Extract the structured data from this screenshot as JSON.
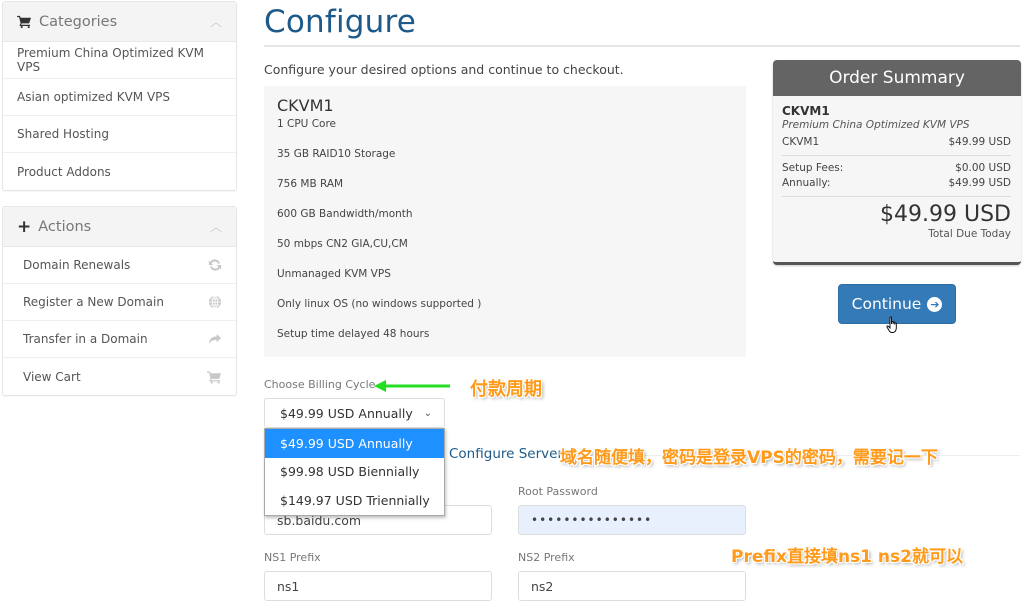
{
  "sidebar": {
    "categories": {
      "title": "Categories",
      "icon": "shopping-cart-icon",
      "items": [
        {
          "label": "Premium China Optimized KVM VPS"
        },
        {
          "label": "Asian optimized KVM VPS"
        },
        {
          "label": "Shared Hosting"
        },
        {
          "label": "Product Addons"
        }
      ]
    },
    "actions": {
      "title": "Actions",
      "icon": "plus-icon",
      "items": [
        {
          "label": "Domain Renewals",
          "icon": "refresh-icon"
        },
        {
          "label": "Register a New Domain",
          "icon": "globe-icon"
        },
        {
          "label": "Transfer in a Domain",
          "icon": "share-arrow-icon"
        },
        {
          "label": "View Cart",
          "icon": "shopping-cart-icon"
        }
      ]
    }
  },
  "main": {
    "title": "Configure",
    "intro": "Configure your desired options and continue to checkout.",
    "product": {
      "name": "CKVM1",
      "features": [
        "1 CPU Core",
        "35 GB RAID10 Storage",
        "756 MB RAM",
        "600 GB Bandwidth/month",
        "50 mbps CN2 GIA,CU,CM",
        "Unmanaged KVM VPS",
        "Only linux OS (no windows supported )",
        "Setup time delayed 48 hours"
      ]
    },
    "billing": {
      "label": "Choose Billing Cycle",
      "selected": "$49.99 USD Annually",
      "options": [
        {
          "label": "$49.99 USD Annually",
          "selected": true
        },
        {
          "label": "$99.98 USD Biennially",
          "selected": false
        },
        {
          "label": "$149.97 USD Triennially",
          "selected": false
        }
      ]
    },
    "configure_server": {
      "title": "Configure Server",
      "hostname_value": "sb.baidu.com",
      "root_password_label": "Root Password",
      "root_password_value": "•••••••••••••••",
      "ns1_label": "NS1 Prefix",
      "ns1_value": "ns1",
      "ns2_label": "NS2 Prefix",
      "ns2_value": "ns2"
    }
  },
  "order_summary": {
    "title": "Order Summary",
    "product_name": "CKVM1",
    "product_group": "Premium China Optimized KVM VPS",
    "line_item_label": "CKVM1",
    "line_item_price": "$49.99 USD",
    "setup_fees_label": "Setup Fees:",
    "setup_fees_value": "$0.00 USD",
    "cycle_label": "Annually:",
    "cycle_value": "$49.99 USD",
    "total": "$49.99 USD",
    "total_caption": "Total Due Today",
    "continue_label": "Continue"
  },
  "annotations": {
    "billing_note": "付款周期",
    "server_note": "域名随便填，密码是登录VPS的密码，需要记一下",
    "prefix_note": "Prefix直接填ns1 ns2就可以"
  },
  "colors": {
    "brand_blue": "#1d5a8a",
    "button_blue": "#337ab7",
    "dropdown_highlight": "#1e90ff",
    "annotation_orange": "#ff9a1a",
    "annotation_arrow_green": "#22dd22"
  }
}
